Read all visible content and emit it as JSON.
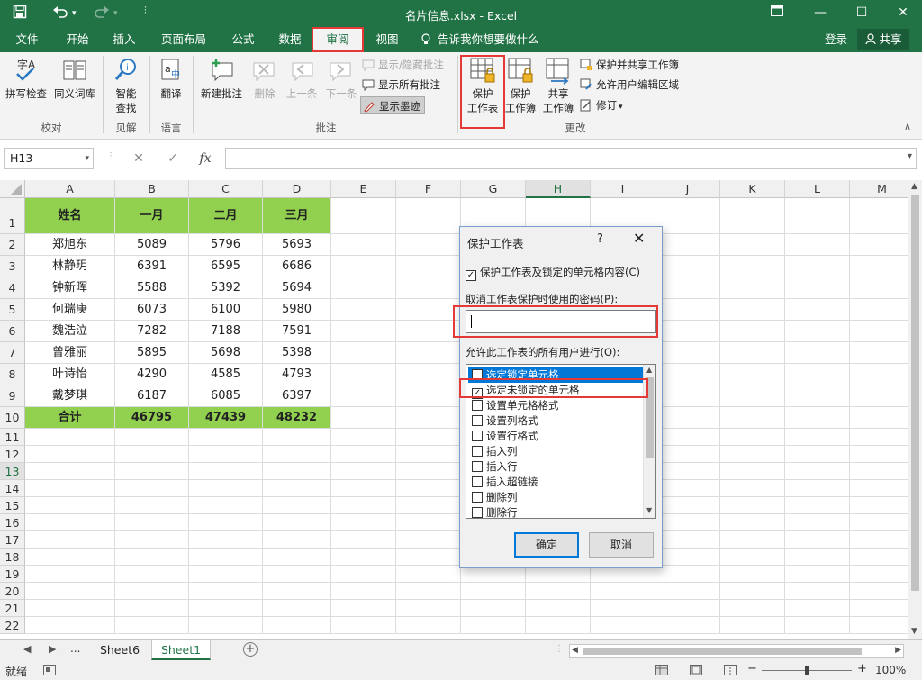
{
  "window": {
    "title": "名片信息.xlsx - Excel",
    "brand_color": "#217346",
    "highlight_color": "#e53935"
  },
  "quick_access": [
    "save-icon",
    "undo-icon",
    "redo-icon",
    "customize-icon"
  ],
  "menu": {
    "tabs": [
      "文件",
      "开始",
      "插入",
      "页面布局",
      "公式",
      "数据",
      "审阅",
      "视图"
    ],
    "active_tab": "审阅",
    "tell_me": "告诉我你想要做什么",
    "login": "登录",
    "share": "共享"
  },
  "ribbon": {
    "groups": {
      "proofing": "校对",
      "insights": "见解",
      "language": "语言",
      "comments": "批注",
      "changes": "更改"
    },
    "spell_check": "拼写检查",
    "thesaurus": "同义词库",
    "smart_lookup_1": "智能",
    "smart_lookup_2": "查找",
    "translate": "翻译",
    "new_comment": "新建批注",
    "delete": "删除",
    "previous": "上一条",
    "next": "下一条",
    "show_hide_comment": "显示/隐藏批注",
    "show_all_comments": "显示所有批注",
    "show_ink": "显示墨迹",
    "protect_sheet_1": "保护",
    "protect_sheet_2": "工作表",
    "protect_workbook_1": "保护",
    "protect_workbook_2": "工作簿",
    "share_workbook_1": "共享",
    "share_workbook_2": "工作簿",
    "protect_share": "保护并共享工作簿",
    "allow_edit_ranges": "允许用户编辑区域",
    "track_changes": "修订"
  },
  "formula_bar": {
    "name_box": "H13",
    "fx": "fx",
    "cancel": "✕",
    "enter": "✓"
  },
  "grid": {
    "columns": [
      "A",
      "B",
      "C",
      "D",
      "E",
      "F",
      "G",
      "H",
      "I",
      "J",
      "K",
      "L",
      "M"
    ],
    "selected_column": "H",
    "selected_row": "13",
    "rows": [
      "1",
      "2",
      "3",
      "4",
      "5",
      "6",
      "7",
      "8",
      "9",
      "10",
      "11",
      "12",
      "13",
      "14",
      "15",
      "16",
      "17",
      "18",
      "19",
      "20",
      "21",
      "22"
    ],
    "header_fill": "#92d050",
    "table": {
      "header": [
        "姓名",
        "一月",
        "二月",
        "三月"
      ],
      "data": [
        [
          "郑旭东",
          "5089",
          "5796",
          "5693"
        ],
        [
          "林静玥",
          "6391",
          "6595",
          "6686"
        ],
        [
          "钟新晖",
          "5588",
          "5392",
          "5694"
        ],
        [
          "何瑞庚",
          "6073",
          "6100",
          "5980"
        ],
        [
          "魏浩泣",
          "7282",
          "7188",
          "7591"
        ],
        [
          "曾雅丽",
          "5895",
          "5698",
          "5398"
        ],
        [
          "叶诗怡",
          "4290",
          "4585",
          "4793"
        ],
        [
          "戴梦琪",
          "6187",
          "6085",
          "6397"
        ]
      ],
      "total": [
        "合计",
        "46795",
        "47439",
        "48232"
      ]
    }
  },
  "sheets": {
    "ellipsis": "...",
    "tabs": [
      "Sheet6",
      "Sheet1"
    ],
    "active": "Sheet1"
  },
  "status": {
    "ready": "就绪",
    "zoom": "100%"
  },
  "dialog": {
    "title": "保护工作表",
    "help": "?",
    "protect_check": "保护工作表及锁定的单元格内容(C)",
    "password_label": "取消工作表保护时使用的密码(P):",
    "allow_label": "允许此工作表的所有用户进行(O):",
    "options": [
      {
        "label": "选定锁定单元格",
        "checked": false
      },
      {
        "label": "选定未锁定的单元格",
        "checked": true
      },
      {
        "label": "设置单元格格式",
        "checked": false
      },
      {
        "label": "设置列格式",
        "checked": false
      },
      {
        "label": "设置行格式",
        "checked": false
      },
      {
        "label": "插入列",
        "checked": false
      },
      {
        "label": "插入行",
        "checked": false
      },
      {
        "label": "插入超链接",
        "checked": false
      },
      {
        "label": "删除列",
        "checked": false
      },
      {
        "label": "删除行",
        "checked": false
      }
    ],
    "ok": "确定",
    "cancel": "取消"
  }
}
